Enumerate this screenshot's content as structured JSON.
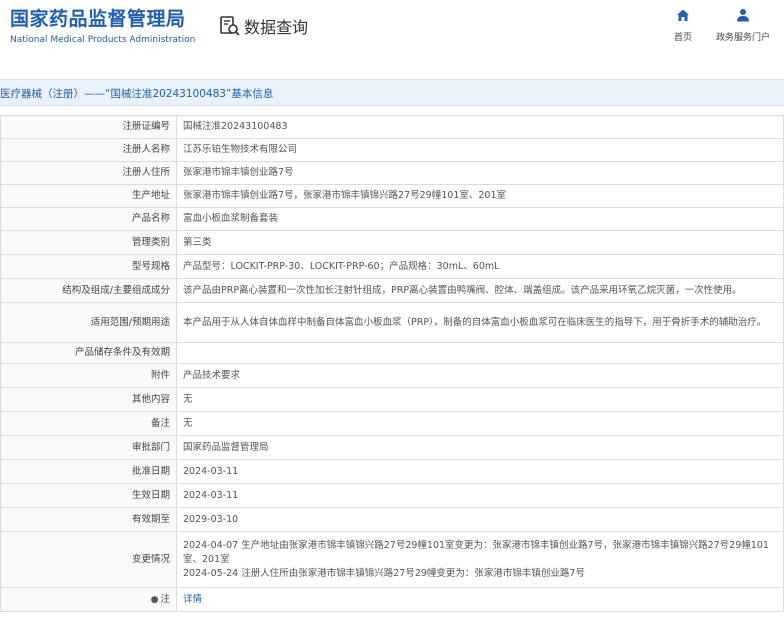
{
  "header": {
    "logo_cn": "国家药品监督管理局",
    "logo_en": "National Medical Products Administration",
    "query_title": "数据查询",
    "nav": [
      {
        "label": "首页",
        "icon": "home-icon"
      },
      {
        "label": "政务服务门户",
        "icon": "user-icon"
      }
    ]
  },
  "breadcrumb": "医疗器械（注册）——“国械注准20243100483”基本信息",
  "rows": [
    {
      "label": "注册证编号",
      "value": "国械注准20243100483"
    },
    {
      "label": "注册人名称",
      "value": "江苏乐铂生物技术有限公司"
    },
    {
      "label": "注册人住所",
      "value": "张家港市锦丰镇创业路7号"
    },
    {
      "label": "生产地址",
      "value": "张家港市锦丰镇创业路7号，张家港市锦丰镇锦兴路27号29幢101室、201室"
    },
    {
      "label": "产品名称",
      "value": "富血小板血浆制备套装"
    },
    {
      "label": "管理类别",
      "value": "第三类"
    },
    {
      "label": "型号规格",
      "value": "产品型号：LOCKIT-PRP-30、LOCKIT-PRP-60；产品规格：30mL、60mL"
    },
    {
      "label": "结构及组成/主要组成成分",
      "value": "该产品由PRP离心装置和一次性加长注射针组成，PRP离心装置由鸭嘴阀、腔体、端盖组成。该产品采用环氧乙烷灭菌，一次性使用。"
    },
    {
      "label": "适用范围/预期用途",
      "value": "本产品用于从人体自体血样中制备自体富血小板血浆（PRP），制备的自体富血小板血浆可在临床医生的指导下，用于骨折手术的辅助治疗。"
    },
    {
      "label": "产品储存条件及有效期",
      "value": ""
    },
    {
      "label": "附件",
      "value": "产品技术要求"
    },
    {
      "label": "其他内容",
      "value": "无"
    },
    {
      "label": "备注",
      "value": "无"
    },
    {
      "label": "审批部门",
      "value": "国家药品监督管理局"
    },
    {
      "label": "批准日期",
      "value": "2024-03-11"
    },
    {
      "label": "生效日期",
      "value": "2024-03-11"
    },
    {
      "label": "有效期至",
      "value": "2029-03-10"
    }
  ],
  "change_row": {
    "label": "变更情况",
    "lines": [
      "2024-04-07 生产地址由张家港市锦丰镇锦兴路27号29幢101室变更为：张家港市锦丰镇创业路7号，张家港市锦丰镇锦兴路27号29幢101室、201室",
      "2024-05-24 注册人住所由张家港市锦丰镇锦兴路27号29幢变更为：张家港市锦丰镇创业路7号"
    ]
  },
  "note_row": {
    "label": "注",
    "icon": "bulb-icon",
    "link": "详情"
  }
}
